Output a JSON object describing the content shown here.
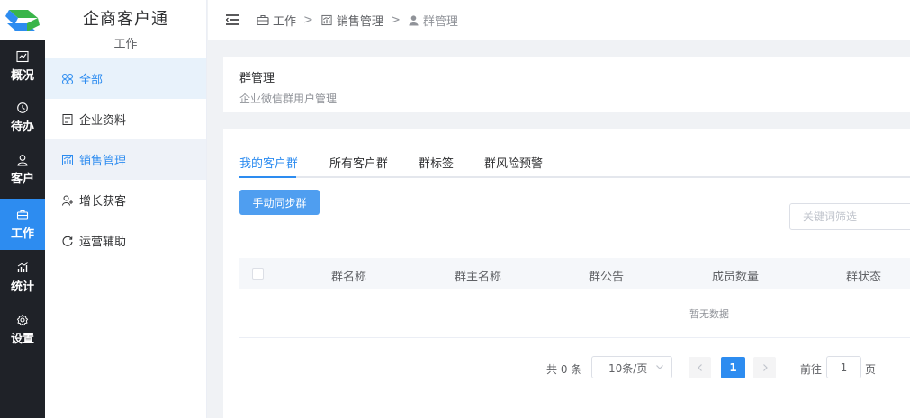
{
  "app": {
    "brand": "企商客户通",
    "section": "工作"
  },
  "rail": [
    {
      "label": "概况",
      "icon": "chart-line-icon"
    },
    {
      "label": "待办",
      "icon": "clock-icon"
    },
    {
      "label": "客户",
      "icon": "user-icon"
    },
    {
      "label": "工作",
      "icon": "briefcase-icon",
      "active": true
    },
    {
      "label": "统计",
      "icon": "bar-chart-icon"
    },
    {
      "label": "设置",
      "icon": "gear-icon"
    }
  ],
  "sub_menu": [
    {
      "label": "全部",
      "icon": "grid-icon",
      "active": true
    },
    {
      "label": "企业资料",
      "icon": "document-icon"
    },
    {
      "label": "销售管理",
      "icon": "sales-chart-icon"
    },
    {
      "label": "增长获客",
      "icon": "add-user-icon"
    },
    {
      "label": "运营辅助",
      "icon": "cycle-icon"
    }
  ],
  "breadcrumb": [
    "工作",
    "销售管理",
    "群管理"
  ],
  "page": {
    "title": "群管理",
    "subtitle": "企业微信群用户管理"
  },
  "tabs": [
    "我的客户群",
    "所有客户群",
    "群标签",
    "群风险预警"
  ],
  "actions": {
    "sync_button": "手动同步群"
  },
  "search": {
    "placeholder": "关键词筛选",
    "value": ""
  },
  "table": {
    "columns": [
      "群名称",
      "群主名称",
      "群公告",
      "成员数量",
      "群状态"
    ],
    "rows": [],
    "empty_text": "暂无数据"
  },
  "pagination": {
    "total_text": "共 0 条",
    "page_size": "10条/页",
    "current_page": "1",
    "goto_label": "前往",
    "goto_value": "1",
    "page_unit": "页"
  },
  "colors": {
    "accent": "#2d8cf0",
    "rail_bg": "#1f2228",
    "logo_green": "#3ab54a"
  }
}
